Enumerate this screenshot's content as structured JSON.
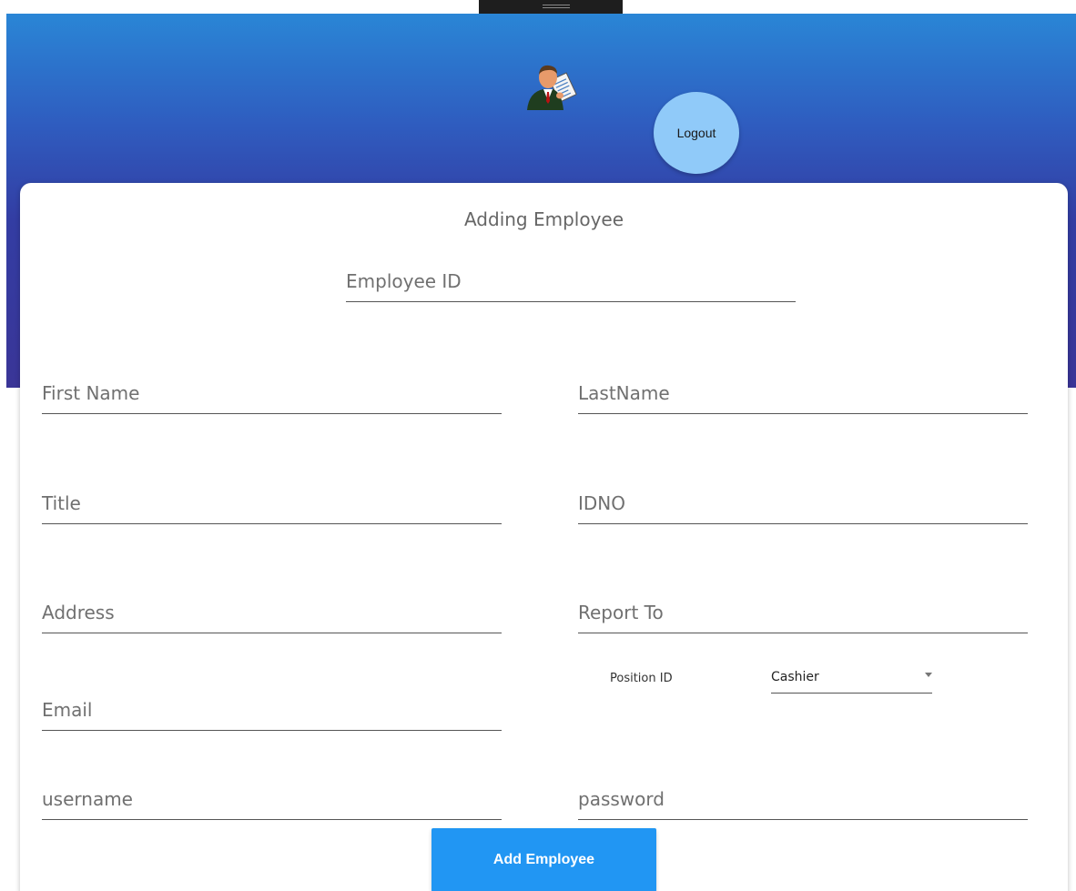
{
  "header": {
    "avatar_icon": "businessman-avatar-icon",
    "logout_label": "Logout",
    "logout_color": "#90caf9"
  },
  "form": {
    "title": "Adding Employee",
    "fields": {
      "employee_id": "Employee ID",
      "first_name": "First Name",
      "last_name": "LastName",
      "title": "Title",
      "idno": "IDNO",
      "address": "Address",
      "report_to": "Report To",
      "email": "Email",
      "username": "username",
      "password": "password"
    },
    "position": {
      "label": "Position ID",
      "selected": "Cashier"
    },
    "submit_label": "Add Employee",
    "submit_color": "#2196f3"
  }
}
